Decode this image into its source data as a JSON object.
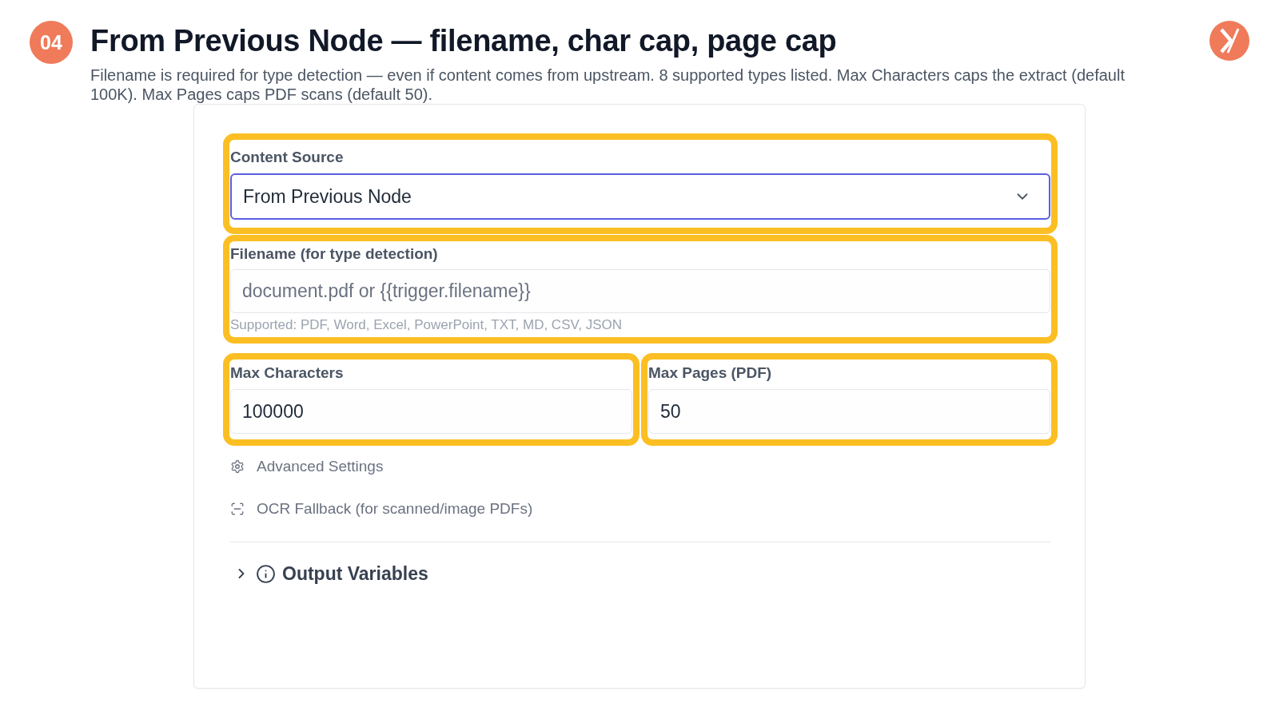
{
  "header": {
    "step": "04",
    "title": "From Previous Node — filename, char cap, page cap",
    "description": "Filename is required for type detection — even if content comes from upstream. 8 supported types listed. Max Characters caps the extract (default 100K). Max Pages caps PDF scans (default 50)."
  },
  "form": {
    "rows": [
      {
        "fields": [
          {
            "kind": "select",
            "label": "Content Source",
            "value": "From Previous Node",
            "focused": true,
            "highlighted": true
          }
        ]
      },
      {
        "fields": [
          {
            "kind": "text",
            "label": "Filename (for type detection)",
            "placeholder": "document.pdf or {{trigger.filename}}",
            "hint": "Supported: PDF, Word, Excel, PowerPoint, TXT, MD, CSV, JSON",
            "highlighted": true
          }
        ]
      },
      {
        "fields": [
          {
            "kind": "number",
            "label": "Max Characters",
            "value": "100000",
            "highlighted": true
          },
          {
            "kind": "number",
            "label": "Max Pages (PDF)",
            "value": "50",
            "highlighted": true
          }
        ]
      }
    ],
    "options": [
      {
        "kind": "settings",
        "label": "Advanced Settings"
      },
      {
        "kind": "scan",
        "label": "OCR Fallback (for scanned/image PDFs)"
      }
    ],
    "output_section": {
      "label": "Output Variables",
      "expanded": false
    }
  }
}
